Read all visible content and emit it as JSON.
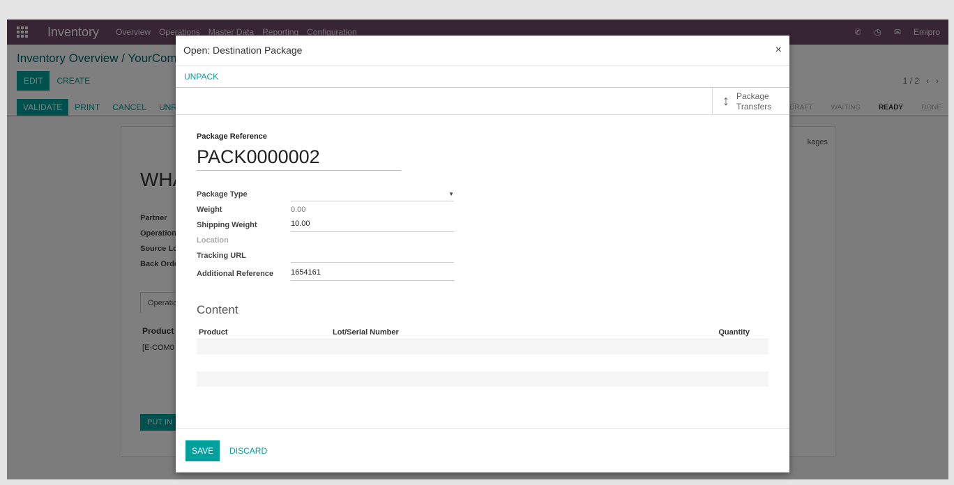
{
  "app": {
    "brand": "Inventory",
    "menu": [
      "Overview",
      "Operations",
      "Master Data",
      "Reporting",
      "Configuration"
    ],
    "user": "Emipro"
  },
  "control": {
    "breadcrumb": "Inventory Overview / YourComp",
    "edit": "EDIT",
    "create": "CREATE",
    "pager": "1 / 2"
  },
  "status_actions": {
    "validate": "VALIDATE",
    "print": "PRINT",
    "cancel": "CANCEL",
    "unreserve": "UNRE"
  },
  "stages": [
    "DRAFT",
    "WAITING",
    "READY",
    "DONE"
  ],
  "background_sheet": {
    "title": "WHA",
    "labels": [
      "Partner",
      "Operation",
      "Source Lo",
      "Back Orde"
    ],
    "tab": "Operatio",
    "table_header": "Product",
    "row_value": "[E-COM0",
    "put_in_pack": "PUT IN",
    "packages_tab": "kages"
  },
  "modal": {
    "title": "Open: Destination Package",
    "close_icon": "×",
    "unpack": "UNPACK",
    "smart_button": {
      "line1": "Package",
      "line2": "Transfers",
      "icon": "arrows-v-icon"
    },
    "package_reference_label": "Package Reference",
    "package_reference": "PACK0000002",
    "fields": {
      "package_type": {
        "label": "Package Type",
        "value": ""
      },
      "weight": {
        "label": "Weight",
        "value": "0.00"
      },
      "shipping_weight": {
        "label": "Shipping Weight",
        "value": "10.00"
      },
      "location": {
        "label": "Location",
        "value": ""
      },
      "tracking_url": {
        "label": "Tracking URL",
        "value": ""
      },
      "additional_reference": {
        "label": "Additional Reference",
        "value": "1654161"
      }
    },
    "content_title": "Content",
    "table": {
      "columns": [
        "Product",
        "Lot/Serial Number",
        "Quantity"
      ]
    },
    "save": "SAVE",
    "discard": "DISCARD"
  },
  "colors": {
    "brand": "#714b67",
    "accent": "#00a09d"
  }
}
